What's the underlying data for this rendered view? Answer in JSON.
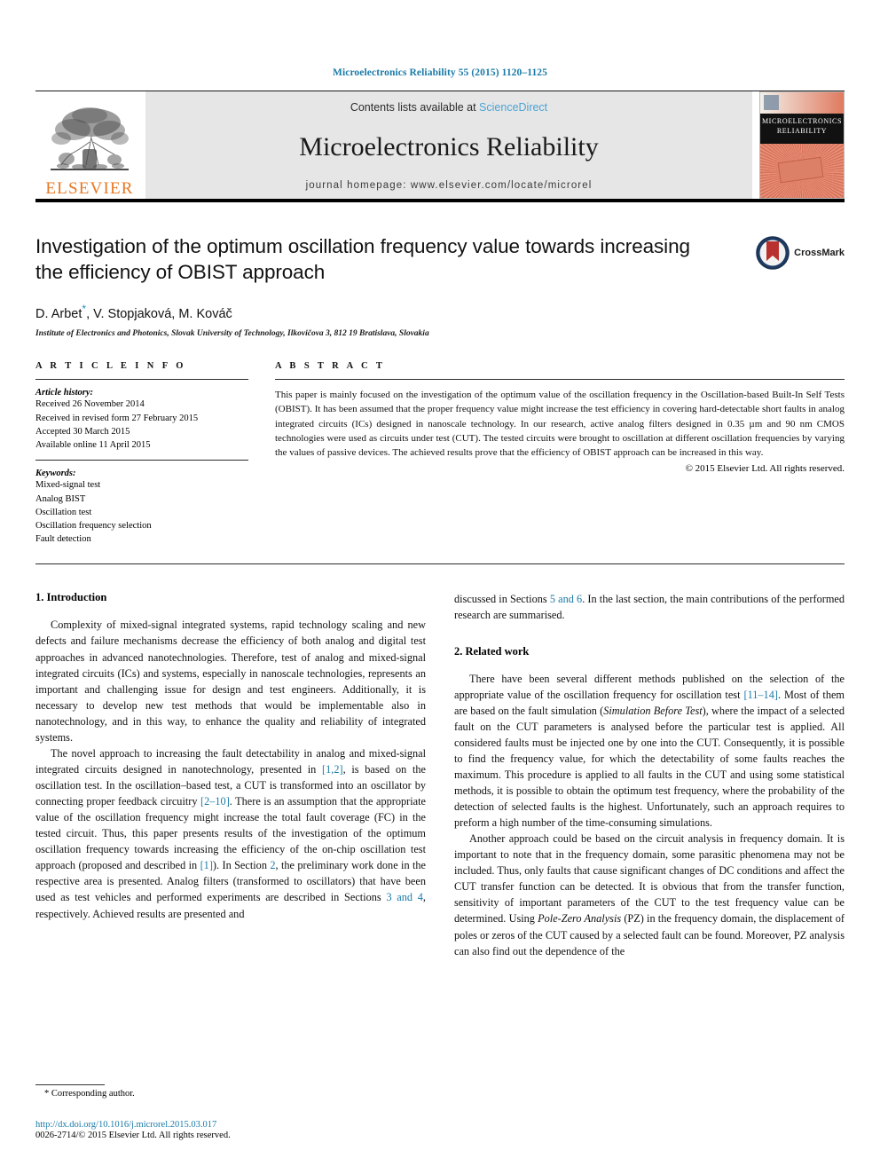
{
  "running_head": "Microelectronics Reliability 55 (2015) 1120–1125",
  "masthead": {
    "contents_prefix": "Contents lists available at ",
    "sciencedirect": "ScienceDirect",
    "journal_title": "Microelectronics Reliability",
    "homepage": "journal homepage: www.elsevier.com/locate/microrel",
    "publisher_logo_text": "ELSEVIER",
    "cover_title_line1": "MICROELECTRONICS",
    "cover_title_line2": "RELIABILITY"
  },
  "colors": {
    "link_blue": "#1a7aa8",
    "sciencedirect_blue": "#4ba3d6",
    "elsevier_orange": "#e87722",
    "masthead_gray": "#e6e6e6",
    "crossmark_ribbon_red": "#b8312f",
    "crossmark_circle_blue": "#1f3b63"
  },
  "article": {
    "title": "Investigation of the optimum oscillation frequency value towards increasing the efficiency of OBIST approach",
    "authors": "D. Arbet , V. Stopjaková, M. Kováč",
    "authors_parts": {
      "a1": "D. Arbet",
      "star": "*",
      "a2": ", V. Stopjaková, M. Kováč"
    },
    "affiliation": "Institute of Electronics and Photonics, Slovak University of Technology, Ilkovičova 3, 812 19 Bratislava, Slovakia",
    "crossmark_label": "CrossMark"
  },
  "article_info": {
    "heading": "A R T I C L E    I N F O",
    "history_title": "Article history:",
    "history": [
      "Received 26 November 2014",
      "Received in revised form 27 February 2015",
      "Accepted 30 March 2015",
      "Available online 11 April 2015"
    ],
    "keywords_title": "Keywords:",
    "keywords": [
      "Mixed-signal test",
      "Analog BIST",
      "Oscillation test",
      "Oscillation frequency selection",
      "Fault detection"
    ]
  },
  "abstract": {
    "heading": "A B S T R A C T",
    "text": "This paper is mainly focused on the investigation of the optimum value of the oscillation frequency in the Oscillation-based Built-In Self Tests (OBIST). It has been assumed that the proper frequency value might increase the test efficiency in covering hard-detectable short faults in analog integrated circuits (ICs) designed in nanoscale technology. In our research, active analog filters designed in 0.35 µm and 90 nm CMOS technologies were used as circuits under test (CUT). The tested circuits were brought to oscillation at different oscillation frequencies by varying the values of passive devices. The achieved results prove that the efficiency of OBIST approach can be increased in this way.",
    "copyright": "© 2015 Elsevier Ltd. All rights reserved."
  },
  "sections": {
    "introduction_heading": "1. Introduction",
    "intro_p1": "Complexity of mixed-signal integrated systems, rapid technology scaling and new defects and failure mechanisms decrease the efficiency of both analog and digital test approaches in advanced nanotechnologies. Therefore, test of analog and mixed-signal integrated circuits (ICs) and systems, especially in nanoscale technologies, represents an important and challenging issue for design and test engineers. Additionally, it is necessary to develop new test methods that would be implementable also in nanotechnology, and in this way, to enhance the quality and reliability of integrated systems.",
    "intro_p2_a": "The novel approach to increasing the fault detectability in analog and mixed-signal integrated circuits designed in nanotechnology, presented in ",
    "intro_p2_c1": "[1,2]",
    "intro_p2_b": ", is based on the oscillation test. In the oscillation–based test, a CUT is transformed into an oscillator by connecting proper feedback circuitry ",
    "intro_p2_c2": "[2–10]",
    "intro_p2_d": ". There is an assumption that the appropriate value of the oscillation frequency might increase the total fault coverage (FC) in the tested circuit. Thus, this paper presents results of the investigation of the optimum oscillation frequency towards increasing the efficiency of the on-chip oscillation test approach (proposed and described in ",
    "intro_p2_c3": "[1]",
    "intro_p2_e": "). In Section ",
    "intro_p2_c4": "2",
    "intro_p2_f": ", the preliminary work done in the respective area is presented. Analog filters (transformed to oscillators) that have been used as test vehicles and performed experiments are described in Sections ",
    "intro_p2_c5": "3 and 4",
    "intro_p2_g": ", respectively. Achieved results are presented and",
    "right_cont_a": "discussed in Sections ",
    "right_cont_c1": "5 and 6",
    "right_cont_b": ". In the last section, the main contributions of the performed research are summarised.",
    "related_heading": "2. Related work",
    "related_p1_a": "There have been several different methods published on the selection of the appropriate value of the oscillation frequency for oscillation test ",
    "related_p1_c1": "[11–14]",
    "related_p1_b": ". Most of them are based on the fault simulation (",
    "related_p1_i1": "Simulation Before Test",
    "related_p1_c": "), where the impact of a selected fault on the CUT parameters is analysed before the particular test is applied. All considered faults must be injected one by one into the CUT. Consequently, it is possible to find the frequency value, for which the detectability of some faults reaches the maximum. This procedure is applied to all faults in the CUT and using some statistical methods, it is possible to obtain the optimum test frequency, where the probability of the detection of selected faults is the highest. Unfortunately, such an approach requires to preform a high number of the time-consuming simulations.",
    "related_p2_a": "Another approach could be based on the circuit analysis in frequency domain. It is important to note that in the frequency domain, some parasitic phenomena may not be included. Thus, only faults that cause significant changes of DC conditions and affect the CUT transfer function can be detected. It is obvious that from the transfer function, sensitivity of important parameters of the CUT to the test frequency value can be determined. Using ",
    "related_p2_i1": "Pole-Zero Analysis",
    "related_p2_b": " (PZ) in the frequency domain, the displacement of poles or zeros of the CUT caused by a selected fault can be found. Moreover, PZ analysis can also find out the dependence of the"
  },
  "footer": {
    "corresponding_author": "* Corresponding author.",
    "doi": "http://dx.doi.org/10.1016/j.microrel.2015.03.017",
    "issn_copyright": "0026-2714/© 2015 Elsevier Ltd. All rights reserved."
  }
}
